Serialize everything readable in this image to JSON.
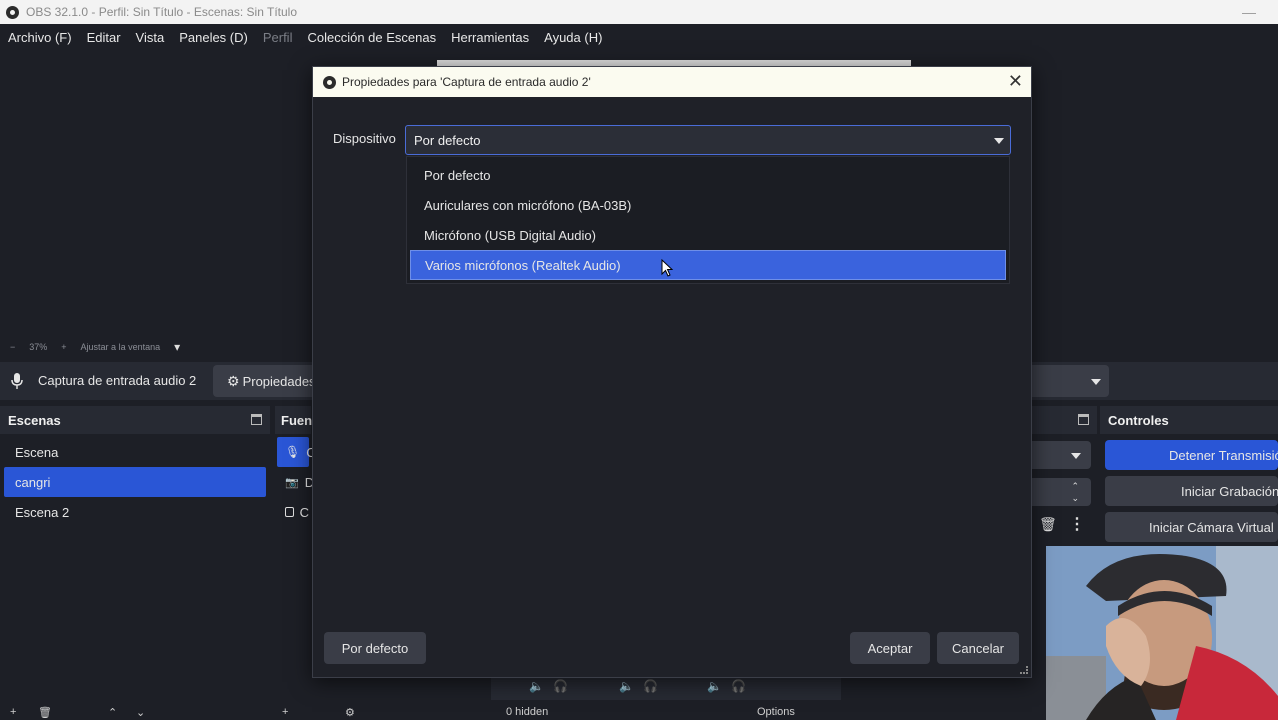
{
  "app": {
    "window_title": "OBS 32.1.0 - Perfil: Sin Título - Escenas: Sin Título",
    "minimize_glyph": "—"
  },
  "menu": {
    "items": [
      {
        "label": "Archivo (F)"
      },
      {
        "label": "Editar"
      },
      {
        "label": "Vista"
      },
      {
        "label": "Paneles (D)"
      },
      {
        "label": "Perfil",
        "disabled": true
      },
      {
        "label": "Colección de Escenas"
      },
      {
        "label": "Herramientas"
      },
      {
        "label": "Ayuda (H)"
      }
    ]
  },
  "zoom": {
    "minus": "−",
    "level": "37%",
    "plus": "+",
    "fit_label": "Ajustar a la ventana",
    "dropdown": "▾"
  },
  "source_toolbar": {
    "source_name": "Captura de entrada audio 2",
    "properties_label": "Propiedades"
  },
  "scenes_dock": {
    "title": "Escenas",
    "items": [
      {
        "label": "Escena"
      },
      {
        "label": "cangri",
        "selected": true
      },
      {
        "label": "Escena 2"
      }
    ]
  },
  "sources_dock": {
    "title": "Fuentes",
    "title_visible": "Fuen",
    "row_labels": [
      "C",
      "D",
      "C"
    ]
  },
  "controls_dock": {
    "title": "Controles",
    "buttons": [
      {
        "label": "Detener Transmisión"
      },
      {
        "label": "Iniciar Grabación"
      },
      {
        "label": "Iniciar Cámara Virtual"
      }
    ]
  },
  "mixer": {
    "hidden_label": "0 hidden",
    "options_label": "Options"
  },
  "dialog": {
    "title": "Propiedades para 'Captura de entrada audio 2'",
    "device_label": "Dispositivo",
    "device_value": "Por defecto",
    "options": [
      {
        "label": "Por defecto"
      },
      {
        "label": "Auriculares con micrófono (BA-03B)"
      },
      {
        "label": "Micrófono (USB Digital Audio)"
      },
      {
        "label": "Varios micrófonos (Realtek Audio)",
        "highlighted": true
      }
    ],
    "defaults_button": "Por defecto",
    "ok_button": "Aceptar",
    "cancel_button": "Cancelar",
    "close_glyph": "✕"
  },
  "colors": {
    "accent": "#2a56d6",
    "highlight": "#3a63dd",
    "background": "#1d1f26",
    "panel": "#272a33"
  }
}
